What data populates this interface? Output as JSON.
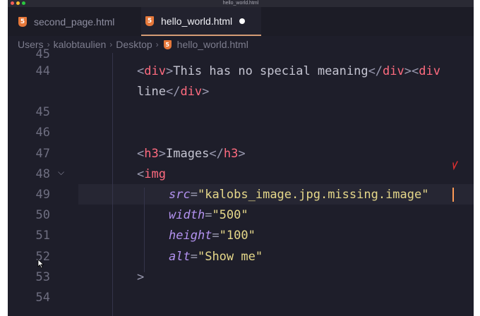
{
  "window": {
    "title": "hello_world.html"
  },
  "tabs": [
    {
      "label": "second_page.html",
      "icon": "html5-icon",
      "active": false
    },
    {
      "label": "hello_world.html",
      "icon": "html5-icon",
      "active": true,
      "unsaved": true
    }
  ],
  "breadcrumb": {
    "items": [
      "Users",
      "kalobtaulien",
      "Desktop",
      "hello_world.html"
    ]
  },
  "icons": {
    "html5_glyph": "5"
  },
  "editor": {
    "lines": [
      {
        "num": "45",
        "tokens": []
      },
      {
        "num": "44",
        "tokens": [
          {
            "t": "<",
            "c": "p"
          },
          {
            "t": "div",
            "c": "t"
          },
          {
            "t": ">",
            "c": "p"
          },
          {
            "t": "This has no special meaning",
            "c": "txt"
          },
          {
            "t": "</",
            "c": "p"
          },
          {
            "t": "div",
            "c": "t"
          },
          {
            "t": ">",
            "c": "p"
          },
          {
            "t": "<",
            "c": "p"
          },
          {
            "t": "div",
            "c": "t"
          }
        ]
      },
      {
        "num": "",
        "tokens": [
          {
            "t": "line",
            "c": "txt"
          },
          {
            "t": "</",
            "c": "p"
          },
          {
            "t": "div",
            "c": "t"
          },
          {
            "t": ">",
            "c": "p"
          }
        ]
      },
      {
        "num": "",
        "tokens": []
      },
      {
        "num": "45",
        "tokens": []
      },
      {
        "num": "46",
        "tokens": []
      },
      {
        "num": "47",
        "tokens": [
          {
            "t": "<",
            "c": "p"
          },
          {
            "t": "h3",
            "c": "t"
          },
          {
            "t": ">",
            "c": "p"
          },
          {
            "t": "Images",
            "c": "txt"
          },
          {
            "t": "</",
            "c": "p"
          },
          {
            "t": "h3",
            "c": "t"
          },
          {
            "t": ">",
            "c": "p"
          }
        ]
      },
      {
        "num": "48",
        "tokens": [
          {
            "t": "<",
            "c": "p"
          },
          {
            "t": "img",
            "c": "t"
          }
        ]
      },
      {
        "num": "49",
        "tokens": [
          {
            "t": "src",
            "c": "a"
          },
          {
            "t": "=",
            "c": "p"
          },
          {
            "t": "\"kalobs_image.jpg.missing.image\"",
            "c": "s"
          }
        ]
      },
      {
        "num": "50",
        "tokens": [
          {
            "t": "width",
            "c": "a"
          },
          {
            "t": "=",
            "c": "p"
          },
          {
            "t": "\"500\"",
            "c": "s"
          }
        ]
      },
      {
        "num": "51",
        "tokens": [
          {
            "t": "height",
            "c": "a"
          },
          {
            "t": "=",
            "c": "p"
          },
          {
            "t": "\"100\"",
            "c": "s"
          }
        ]
      },
      {
        "num": "52",
        "tokens": [
          {
            "t": "alt",
            "c": "a"
          },
          {
            "t": "=",
            "c": "p"
          },
          {
            "t": "\"Show me\"",
            "c": "s"
          }
        ]
      },
      {
        "num": "53",
        "tokens": [
          {
            "t": ">",
            "c": "p"
          }
        ]
      },
      {
        "num": "54",
        "tokens": []
      }
    ]
  },
  "colors": {
    "editor_bg": "#1e1e2a",
    "tag": "#ff6b7f",
    "attribute": "#b392f0",
    "string": "#e6d88a",
    "cursor": "#ff9a55"
  }
}
